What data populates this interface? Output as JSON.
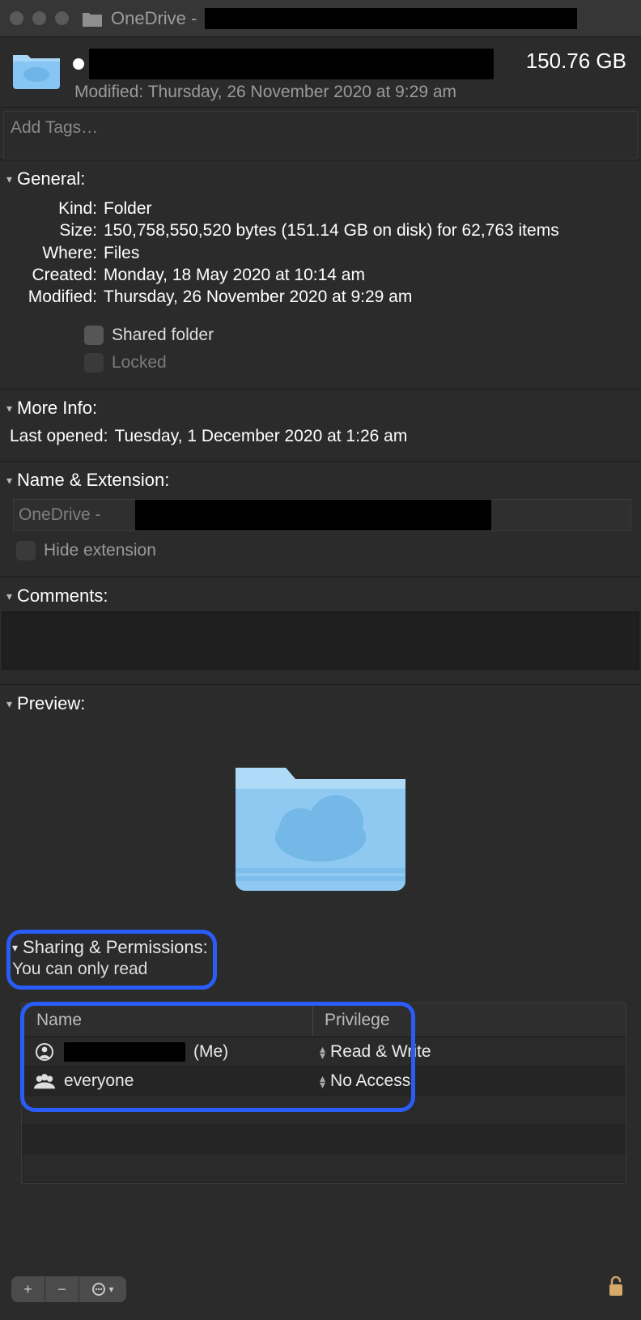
{
  "titlebar": {
    "title_prefix": "OneDrive -"
  },
  "header": {
    "modified_label": "Modified:",
    "modified_value": "Thursday, 26 November 2020 at 9:29 am",
    "size": "150.76 GB"
  },
  "tags": {
    "placeholder": "Add Tags…"
  },
  "general": {
    "title": "General:",
    "rows": {
      "kind": {
        "label": "Kind:",
        "value": "Folder"
      },
      "size": {
        "label": "Size:",
        "value": "150,758,550,520 bytes (151.14 GB on disk) for 62,763 items"
      },
      "where": {
        "label": "Where:",
        "value": "Files"
      },
      "created": {
        "label": "Created:",
        "value": "Monday, 18 May 2020 at 10:14 am"
      },
      "modified": {
        "label": "Modified:",
        "value": "Thursday, 26 November 2020 at 9:29 am"
      }
    },
    "shared_folder_label": "Shared folder",
    "locked_label": "Locked"
  },
  "more_info": {
    "title": "More Info:",
    "last_opened_label": "Last opened:",
    "last_opened_value": "Tuesday, 1 December 2020 at 1:26 am"
  },
  "name_ext": {
    "title": "Name & Extension:",
    "value_prefix": "OneDrive - ",
    "hide_extension_label": "Hide extension"
  },
  "comments": {
    "title": "Comments:"
  },
  "preview": {
    "title": "Preview:"
  },
  "sharing": {
    "title": "Sharing & Permissions:",
    "subtitle": "You can only read",
    "columns": {
      "name": "Name",
      "privilege": "Privilege"
    },
    "rows": [
      {
        "name_suffix": "(Me)",
        "privilege": "Read & Write"
      },
      {
        "name": "everyone",
        "privilege": "No Access"
      }
    ]
  },
  "footer": {
    "add": "+",
    "remove": "−",
    "gear": "⊙"
  }
}
